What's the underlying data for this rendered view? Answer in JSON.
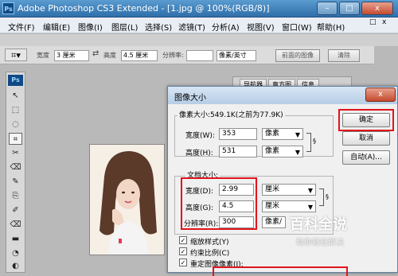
{
  "app": {
    "title": "Adobe Photoshop CS3 Extended - [1.jpg @ 100%(RGB/8)]",
    "logo": "Ps",
    "window_buttons": [
      "–",
      "□",
      "x"
    ]
  },
  "menu": {
    "items": [
      "文件(F)",
      "编辑(E)",
      "图像(I)",
      "图层(L)",
      "选择(S)",
      "滤镜(T)",
      "分析(A)",
      "视图(V)",
      "窗口(W)",
      "帮助(H)"
    ],
    "right_controls": [
      "□",
      "x"
    ]
  },
  "options_bar": {
    "width_label": "宽度",
    "width_value": "3 厘米",
    "height_label": "高度",
    "height_value": "4.5 厘米",
    "resolution_label": "分辨率:",
    "resolution_value": "",
    "unit_value": "像素/英寸",
    "front_image_label": "前面的图像",
    "clear_label": "清除"
  },
  "toolbox": {
    "header": "Ps",
    "tools": [
      "↖",
      "⬚",
      "◌",
      "⌗",
      "✂",
      "⌫",
      "✎",
      "⎘",
      "✐",
      "⌫",
      "▬",
      "◔",
      "◐"
    ]
  },
  "panels": {
    "tabs": [
      "导航器",
      "直方图",
      "信息"
    ]
  },
  "dialog": {
    "title": "图像大小",
    "close_label": "x",
    "pixel_dimensions_label": "像素大小:549.1K(之前为77.9K)",
    "pixel_width_label": "宽度(W):",
    "pixel_width_value": "353",
    "pixel_width_unit": "像素",
    "pixel_height_label": "高度(H):",
    "pixel_height_value": "531",
    "pixel_height_unit": "像素",
    "document_size_label": "文档大小:",
    "doc_width_label": "宽度(D):",
    "doc_width_value": "2.99",
    "doc_width_unit": "厘米",
    "doc_height_label": "高度(G):",
    "doc_height_value": "4.5",
    "doc_height_unit": "厘米",
    "resolution_label": "分辨率(R):",
    "resolution_value": "300",
    "resolution_unit": "像素/",
    "scale_styles_label": "缩放样式(Y)",
    "constrain_label": "约束比例(C)",
    "resample_label": "重定图像像素(I):",
    "ok_label": "确定",
    "cancel_label": "取消",
    "auto_label": "自动(A)..."
  },
  "watermark": {
    "title": "百科全说",
    "subtitle": "助你轻松解决"
  },
  "colors": {
    "highlight": "#e0141c",
    "titlebar": "#2f6fa9"
  }
}
